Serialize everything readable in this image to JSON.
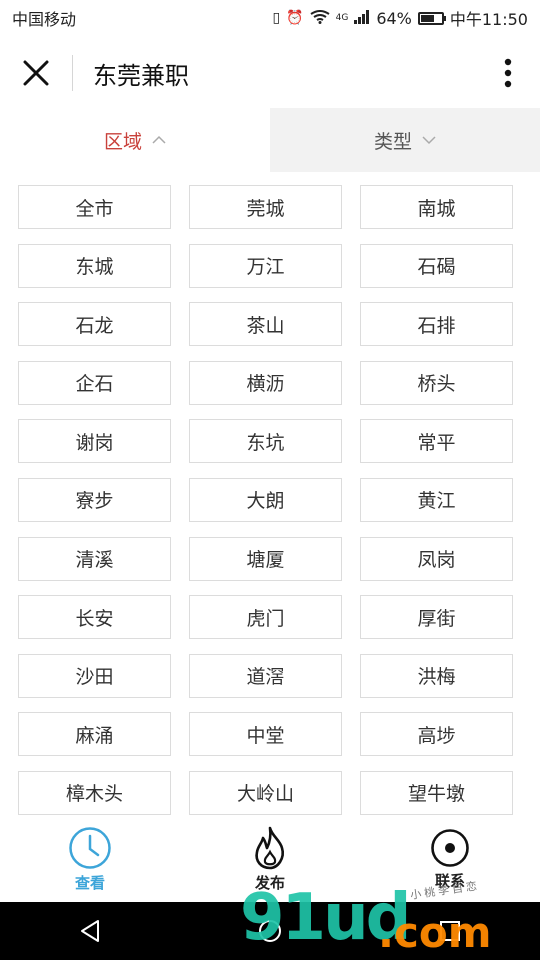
{
  "status_bar": {
    "carrier": "中国移动",
    "network": "4G",
    "battery_percent": "64%",
    "battery_level": 0.64,
    "time": "中午11:50"
  },
  "header": {
    "close_icon": "close-icon",
    "title": "东莞兼职",
    "more_icon": "more-vertical-icon"
  },
  "tabs": [
    {
      "label": "区域",
      "state": "active",
      "icon": "chevron-up-icon"
    },
    {
      "label": "类型",
      "state": "inactive",
      "icon": "chevron-down-icon"
    }
  ],
  "regions": [
    "全市",
    "莞城",
    "南城",
    "东城",
    "万江",
    "石碣",
    "石龙",
    "茶山",
    "石排",
    "企石",
    "横沥",
    "桥头",
    "谢岗",
    "东坑",
    "常平",
    "寮步",
    "大朗",
    "黄江",
    "清溪",
    "塘厦",
    "凤岗",
    "长安",
    "虎门",
    "厚街",
    "沙田",
    "道滘",
    "洪梅",
    "麻涌",
    "中堂",
    "高埗",
    "樟木头",
    "大岭山",
    "望牛墩"
  ],
  "bottom_nav": [
    {
      "label": "查看",
      "icon": "clock-icon",
      "active": true
    },
    {
      "label": "发布",
      "icon": "flame-icon",
      "active": false
    },
    {
      "label": "联系",
      "icon": "target-icon",
      "active": false
    }
  ],
  "watermark": {
    "logo": "91ud",
    "suffix": ".com",
    "handwriting": "小桃李自恋"
  },
  "colors": {
    "accent": "#c9413b",
    "nav_active": "#3da5d9",
    "border": "#dcdcdc"
  }
}
